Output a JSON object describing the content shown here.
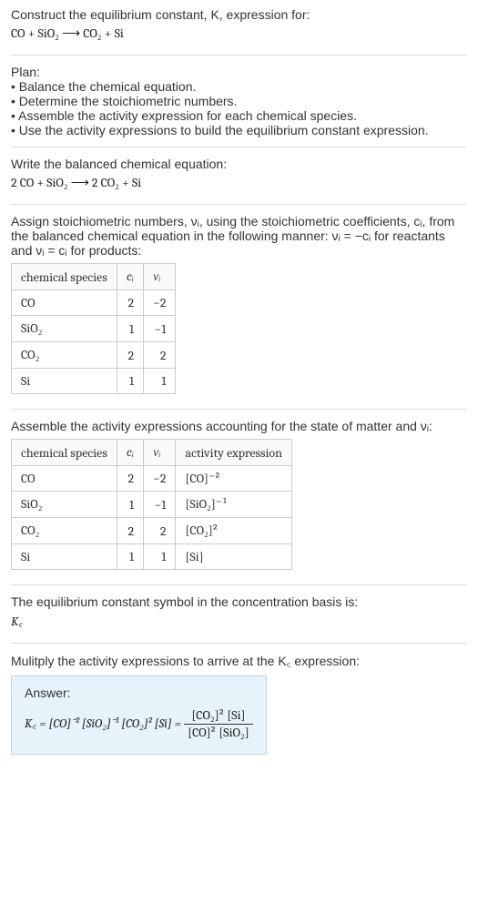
{
  "header": {
    "prompt_line1": "Construct the equilibrium constant, K, expression for:",
    "equation_unbalanced": "CO + SiO₂ ⟶ CO₂ + Si"
  },
  "plan": {
    "title": "Plan:",
    "items": [
      "Balance the chemical equation.",
      "Determine the stoichiometric numbers.",
      "Assemble the activity expression for each chemical species.",
      "Use the activity expressions to build the equilibrium constant expression."
    ]
  },
  "balanced": {
    "intro": "Write the balanced chemical equation:",
    "equation": "2 CO + SiO₂ ⟶ 2 CO₂ + Si"
  },
  "stoich": {
    "intro_a": "Assign stoichiometric numbers, νᵢ, using the stoichiometric coefficients, cᵢ, from the balanced chemical equation in the following manner: νᵢ = −cᵢ for reactants and νᵢ = cᵢ for products:",
    "headers": {
      "species": "chemical species",
      "c": "cᵢ",
      "v": "νᵢ"
    },
    "rows": [
      {
        "species": "CO",
        "c": "2",
        "v": "−2"
      },
      {
        "species": "SiO₂",
        "c": "1",
        "v": "−1"
      },
      {
        "species": "CO₂",
        "c": "2",
        "v": "2"
      },
      {
        "species": "Si",
        "c": "1",
        "v": "1"
      }
    ]
  },
  "activity": {
    "intro": "Assemble the activity expressions accounting for the state of matter and νᵢ:",
    "headers": {
      "species": "chemical species",
      "c": "cᵢ",
      "v": "νᵢ",
      "a": "activity expression"
    },
    "rows": [
      {
        "species": "CO",
        "c": "2",
        "v": "−2",
        "a": "[CO]⁻²"
      },
      {
        "species": "SiO₂",
        "c": "1",
        "v": "−1",
        "a": "[SiO₂]⁻¹"
      },
      {
        "species": "CO₂",
        "c": "2",
        "v": "2",
        "a": "[CO₂]²"
      },
      {
        "species": "Si",
        "c": "1",
        "v": "1",
        "a": "[Si]"
      }
    ]
  },
  "kc_symbol": {
    "intro": "The equilibrium constant symbol in the concentration basis is:",
    "symbol": "K꜀"
  },
  "multiply": {
    "intro": "Mulitply the activity expressions to arrive at the K꜀ expression:"
  },
  "answer": {
    "label": "Answer:",
    "lhs": "K꜀ = [CO]⁻² [SiO₂]⁻¹ [CO₂]² [Si] =",
    "frac_num": "[CO₂]² [Si]",
    "frac_den": "[CO]² [SiO₂]"
  },
  "chart_data": {
    "type": "table",
    "tables": [
      {
        "title": "stoichiometric numbers",
        "columns": [
          "chemical species",
          "cᵢ",
          "νᵢ"
        ],
        "rows": [
          [
            "CO",
            2,
            -2
          ],
          [
            "SiO₂",
            1,
            -1
          ],
          [
            "CO₂",
            2,
            2
          ],
          [
            "Si",
            1,
            1
          ]
        ]
      },
      {
        "title": "activity expressions",
        "columns": [
          "chemical species",
          "cᵢ",
          "νᵢ",
          "activity expression"
        ],
        "rows": [
          [
            "CO",
            2,
            -2,
            "[CO]^-2"
          ],
          [
            "SiO₂",
            1,
            -1,
            "[SiO₂]^-1"
          ],
          [
            "CO₂",
            2,
            2,
            "[CO₂]^2"
          ],
          [
            "Si",
            1,
            1,
            "[Si]"
          ]
        ]
      }
    ]
  }
}
